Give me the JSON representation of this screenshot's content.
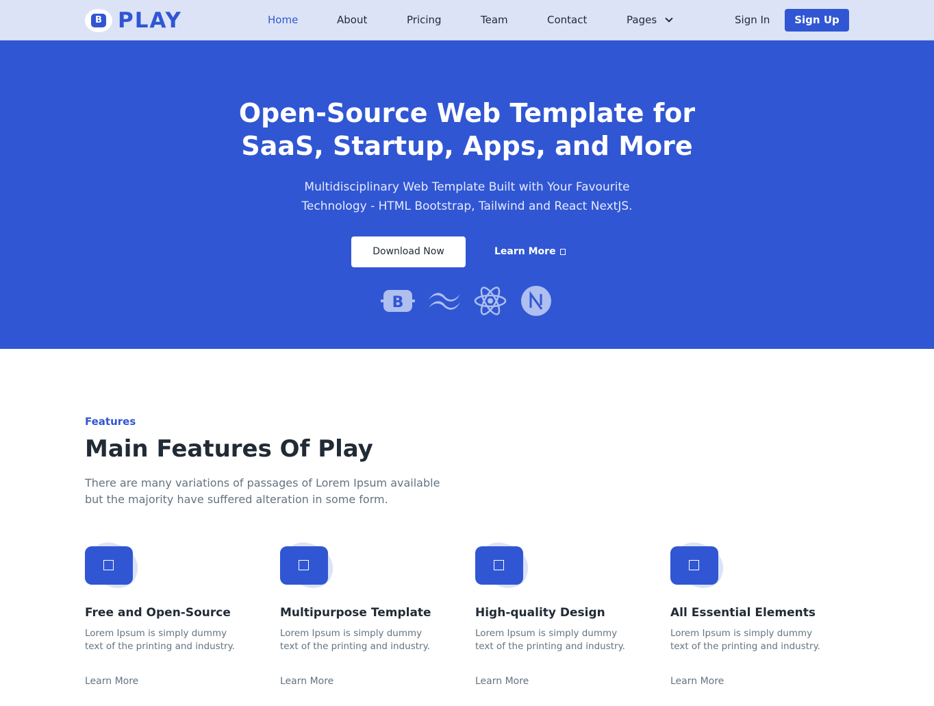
{
  "brand": {
    "logo_letter": "B",
    "name": "PLAY",
    "color": "#3056d3"
  },
  "nav": {
    "items": [
      {
        "label": "Home",
        "active": true
      },
      {
        "label": "About"
      },
      {
        "label": "Pricing"
      },
      {
        "label": "Team"
      },
      {
        "label": "Contact"
      },
      {
        "label": "Pages",
        "has_dropdown": true,
        "icon": "chevron-down-icon"
      }
    ],
    "sign_in": "Sign In",
    "sign_up": "Sign Up"
  },
  "hero": {
    "title_line1": "Open-Source Web Template for",
    "title_line2": "SaaS, Startup, Apps, and More",
    "subtitle_line1": "Multidisciplinary Web Template Built with Your Favourite",
    "subtitle_line2": "Technology - HTML Bootstrap, Tailwind and React NextJS.",
    "download_label": "Download Now",
    "learn_more_label": "Learn More",
    "tech_icons": [
      "bootstrap-icon",
      "tailwind-icon",
      "react-icon",
      "nextjs-icon"
    ],
    "background": "#3056d3"
  },
  "features": {
    "tag": "Features",
    "title": "Main Features Of Play",
    "description_line1": "There are many variations of passages of Lorem Ipsum available",
    "description_line2": "but the majority have suffered alteration in some form.",
    "items": [
      {
        "title": "Free and Open-Source",
        "desc_line1": "Lorem Ipsum is simply dummy",
        "desc_line2": "text of the printing and industry.",
        "link": "Learn More"
      },
      {
        "title": "Multipurpose Template",
        "desc_line1": "Lorem Ipsum is simply dummy",
        "desc_line2": "text of the printing and industry.",
        "link": "Learn More"
      },
      {
        "title": "High-quality Design",
        "desc_line1": "Lorem Ipsum is simply dummy",
        "desc_line2": "text of the printing and industry.",
        "link": "Learn More"
      },
      {
        "title": "All Essential Elements",
        "desc_line1": "Lorem Ipsum is simply dummy",
        "desc_line2": "text of the printing and industry.",
        "link": "Learn More"
      }
    ]
  }
}
